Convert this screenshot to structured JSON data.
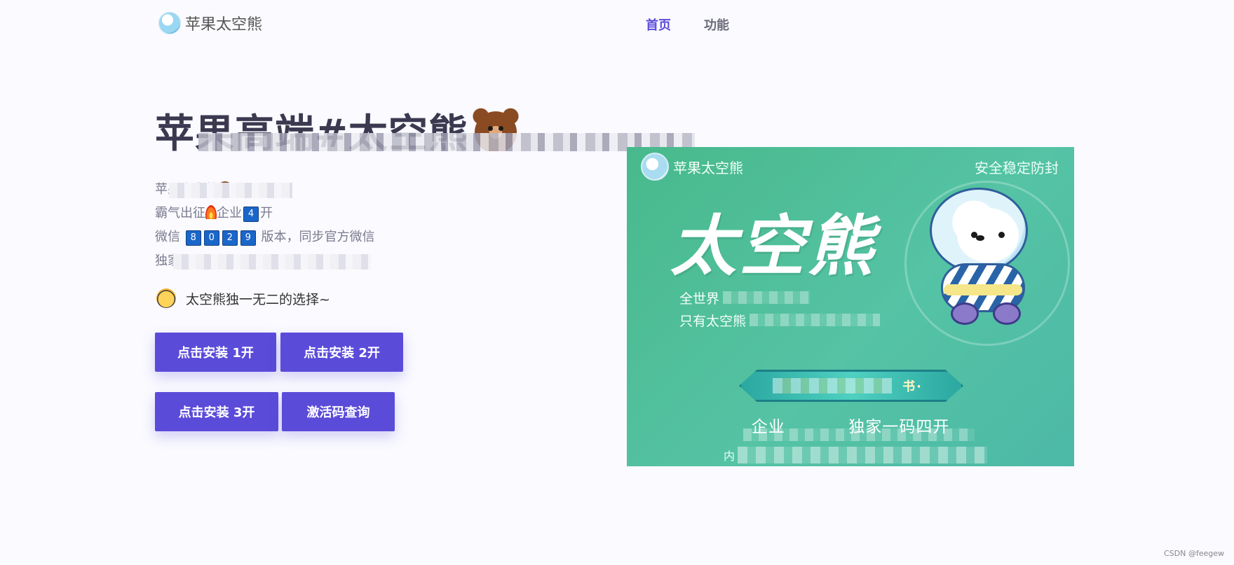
{
  "header": {
    "logo_text": "苹果太空熊",
    "nav": [
      {
        "label": "首页",
        "active": true
      },
      {
        "label": "功能",
        "active": false
      }
    ],
    "accent_color": "#5b4bd9"
  },
  "hero": {
    "title": "苹果高端#太空熊",
    "intro_lines": {
      "line1": "苹果太空熊",
      "line2_a": "霸气出征",
      "line2_b": "企业",
      "line2_key": "4",
      "line2_c": "开",
      "line3_a": "微信",
      "line3_keys": [
        "8",
        "0",
        "2",
        "9"
      ],
      "line3_b": "版本，同步官方微信",
      "line4": "独家"
    },
    "tagline": "太空熊独一无二的选择~"
  },
  "buttons": {
    "install_1": "点击安装 1开",
    "install_2": "点击安装 2开",
    "install_3": "点击安装 3开",
    "activation_query": "激活码查询"
  },
  "promo": {
    "brand": "苹果太空熊",
    "badge": "安全稳定防封",
    "title": "太空熊",
    "sub1": "全世界",
    "sub2": "只有太空熊",
    "banner": "书·",
    "slogan": "企业",
    "slogan_tail": "独家一码四开",
    "foot": "内",
    "bg_color": "#48b98c"
  },
  "watermark": "CSDN @feegew"
}
